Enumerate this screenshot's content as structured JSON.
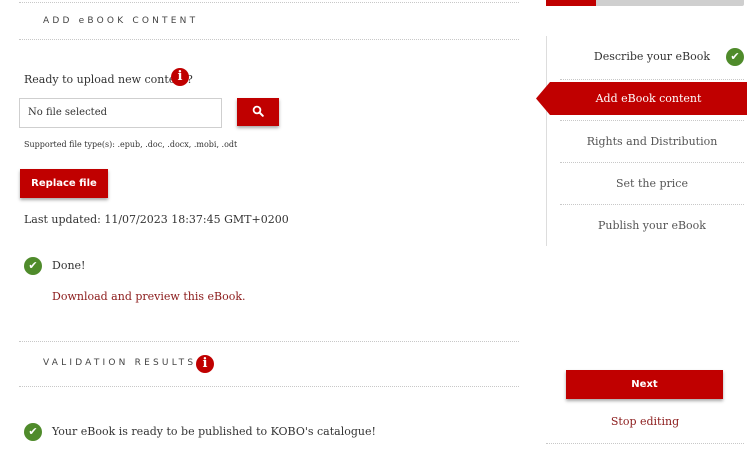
{
  "upload": {
    "section_title": "ADD eBOOK CONTENT",
    "prompt": "Ready to upload new content?",
    "info_glyph": "i",
    "file_input_value": "No file selected",
    "search_glyph": "⚲",
    "supported_types": "Supported file type(s): .epub, .doc, .docx, .mobi, .odt",
    "replace_button": "Replace file",
    "last_updated": "Last updated: 11/07/2023 18:37:45 GMT+0200",
    "status_text": "Done!",
    "download_link": "Download and preview this eBook.",
    "check_glyph": "✔"
  },
  "validation": {
    "section_title": "VALIDATION RESULTS",
    "info_glyph": "i",
    "message": "Your eBook is ready to be published to KOBO's catalogue!",
    "check_glyph": "✔"
  },
  "steps": [
    {
      "label": "Describe your eBook",
      "complete": true,
      "active": false
    },
    {
      "label": "Add eBook content",
      "complete": false,
      "active": true
    },
    {
      "label": "Rights and Distribution",
      "complete": false,
      "active": false
    },
    {
      "label": "Set the price",
      "complete": false,
      "active": false
    },
    {
      "label": "Publish your eBook",
      "complete": false,
      "active": false
    }
  ],
  "steps_check_glyph": "✔",
  "actions": {
    "next_button": "Next",
    "stop_editing": "Stop editing"
  },
  "colors": {
    "accent": "#c00000",
    "success": "#4f8b2b",
    "link": "#8b1a1a"
  }
}
